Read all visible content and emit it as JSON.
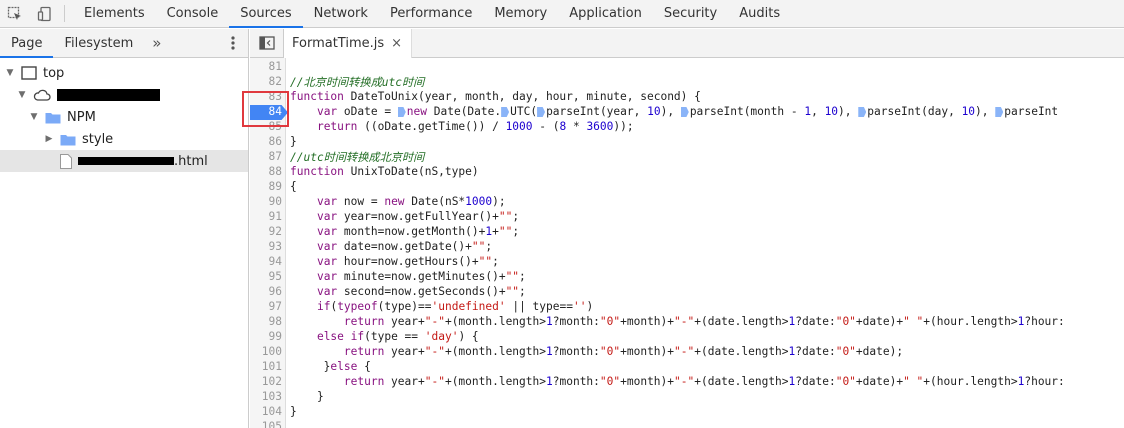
{
  "toolbar": {
    "tabs": [
      "Elements",
      "Console",
      "Sources",
      "Network",
      "Performance",
      "Memory",
      "Application",
      "Security",
      "Audits"
    ],
    "active_tab": "Sources"
  },
  "navigator": {
    "tabs": [
      "Page",
      "Filesystem"
    ],
    "more": "»",
    "tree": {
      "top": "top",
      "npm": "NPM",
      "style": "style",
      "file_suffix": ".html"
    }
  },
  "editor": {
    "file_tab": "FormatTime.js",
    "close_glyph": "×"
  },
  "breakpoint_line": 84,
  "code_lines": [
    {
      "n": "81",
      "text": ""
    },
    {
      "n": "82",
      "text": "//北京时间转换成utc时间"
    },
    {
      "n": "83",
      "text": "function DateToUnix(year, month, day, hour, minute, second) {"
    },
    {
      "n": "84",
      "text": "    var oDate = new Date(Date.UTC(parseInt(year, 10), parseInt(month - 1, 10), parseInt(day, 10), parseInt"
    },
    {
      "n": "85",
      "text": "    return ((oDate.getTime()) / 1000 - (8 * 3600));"
    },
    {
      "n": "86",
      "text": "}"
    },
    {
      "n": "87",
      "text": "//utc时间转换成北京时间"
    },
    {
      "n": "88",
      "text": "function UnixToDate(nS,type)"
    },
    {
      "n": "89",
      "text": "{"
    },
    {
      "n": "90",
      "text": "    var now = new Date(nS*1000);"
    },
    {
      "n": "91",
      "text": "    var year=now.getFullYear()+\"\";"
    },
    {
      "n": "92",
      "text": "    var month=now.getMonth()+1+\"\";"
    },
    {
      "n": "93",
      "text": "    var date=now.getDate()+\"\";"
    },
    {
      "n": "94",
      "text": "    var hour=now.getHours()+\"\";"
    },
    {
      "n": "95",
      "text": "    var minute=now.getMinutes()+\"\";"
    },
    {
      "n": "96",
      "text": "    var second=now.getSeconds()+\"\";"
    },
    {
      "n": "97",
      "text": "    if(typeof(type)=='undefined' || type=='')"
    },
    {
      "n": "98",
      "text": "        return year+\"-\"+(month.length>1?month:\"0\"+month)+\"-\"+(date.length>1?date:\"0\"+date)+\" \"+(hour.length>1?hour:"
    },
    {
      "n": "99",
      "text": "    else if(type == 'day') {"
    },
    {
      "n": "100",
      "text": "        return year+\"-\"+(month.length>1?month:\"0\"+month)+\"-\"+(date.length>1?date:\"0\"+date);"
    },
    {
      "n": "101",
      "text": "     }else {"
    },
    {
      "n": "102",
      "text": "        return year+\"-\"+(month.length>1?month:\"0\"+month)+\"-\"+(date.length>1?date:\"0\"+date)+\" \"+(hour.length>1?hour:"
    },
    {
      "n": "103",
      "text": "    }"
    },
    {
      "n": "104",
      "text": "}"
    },
    {
      "n": "105",
      "text": ""
    }
  ],
  "colors": {
    "accent": "#1a73e8",
    "breakpoint": "#4285f4",
    "annotation_box": "#e0393e",
    "comment": "#236e25",
    "keyword": "#881280",
    "string": "#c41a16"
  }
}
